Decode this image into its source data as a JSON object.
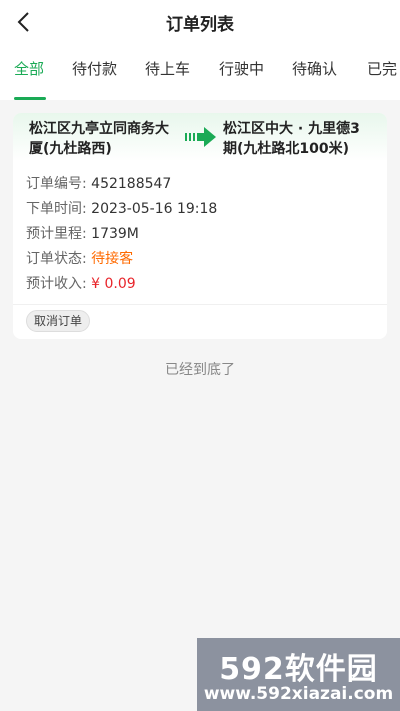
{
  "header": {
    "title": "订单列表",
    "back_icon": "chevron-left-icon"
  },
  "tabs": [
    {
      "label": "全部",
      "active": true
    },
    {
      "label": "待付款",
      "active": false
    },
    {
      "label": "待上车",
      "active": false
    },
    {
      "label": "行驶中",
      "active": false
    },
    {
      "label": "待确认",
      "active": false
    },
    {
      "label": "已完",
      "active": false
    }
  ],
  "order": {
    "from": "松江区九亭立同商务大厦(九杜路西)",
    "to": "松江区中大 · 九里德3期(九杜路北100米)",
    "arrow_icon": "route-arrow-icon",
    "fields": {
      "number_label": "订单编号:",
      "number": "452188547",
      "time_label": "下单时间:",
      "time": "2023-05-16 19:18",
      "distance_label": "预计里程:",
      "distance": "1739M",
      "status_label": "订单状态:",
      "status": "待接客",
      "income_label": "预计收入:",
      "income": "¥ 0.09"
    },
    "cancel_label": "取消订单"
  },
  "list_end_text": "已经到底了",
  "watermark": {
    "line1": "592软件园",
    "line2": "www.592xiazai.com"
  },
  "colors": {
    "accent": "#1aaa55",
    "status": "#ff6a00",
    "income": "#e8242a",
    "background": "#f5f5f5"
  }
}
